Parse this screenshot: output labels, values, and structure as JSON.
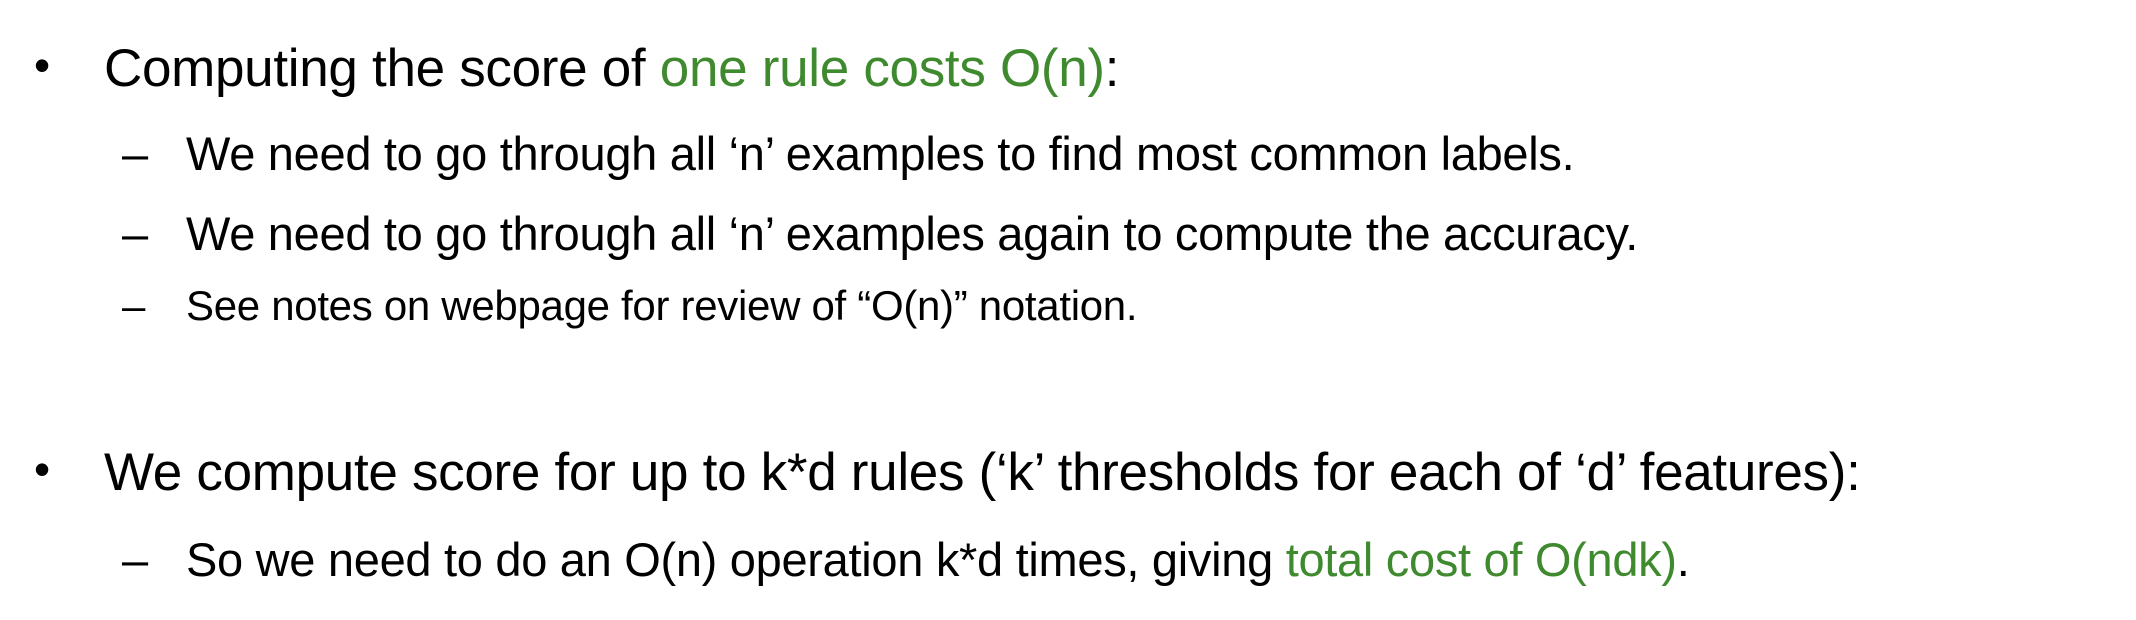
{
  "bullets": [
    {
      "before": "Computing the score of ",
      "highlight": "one rule costs O(n)",
      "after": ":",
      "subs": [
        {
          "text": "We need to go through all ‘n’ examples to find most common labels."
        },
        {
          "text": "We need to go through all ‘n’ examples again to compute the accuracy."
        },
        {
          "text": "See notes on webpage for review of “O(n)” notation."
        }
      ]
    },
    {
      "text": "We compute score for up to k*d rules (‘k’ thresholds for each of ‘d’ features):",
      "subs": [
        {
          "before": "So we need to do an O(n) operation k*d times, giving ",
          "highlight": "total cost of O(ndk)",
          "after": "."
        }
      ]
    }
  ],
  "colors": {
    "text": "#000000",
    "highlight": "#3f8a2f"
  },
  "symbols": {
    "bullet": "•",
    "dash": "–"
  }
}
